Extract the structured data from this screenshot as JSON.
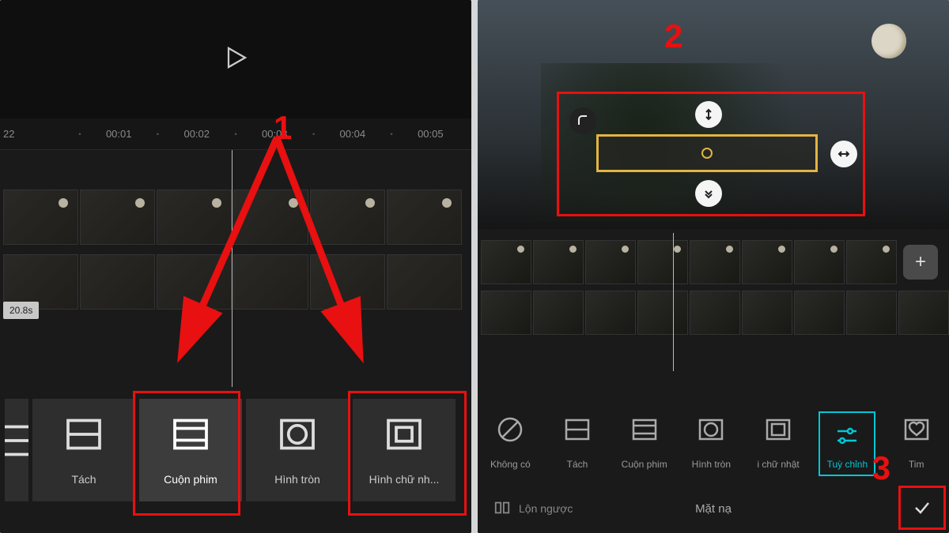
{
  "left": {
    "ruler": [
      "22",
      "00:01",
      "00:02",
      "00:03",
      "00:04",
      "00:05"
    ],
    "duration": "20.8s",
    "options": [
      {
        "id": "tach",
        "label": "Tách"
      },
      {
        "id": "cuonphim",
        "label": "Cuộn phim"
      },
      {
        "id": "hinhtron",
        "label": "Hình tròn"
      },
      {
        "id": "hinhchunhat",
        "label": "Hình chữ nh..."
      }
    ],
    "step": "1"
  },
  "right": {
    "step2": "2",
    "step3": "3",
    "options": [
      {
        "id": "khongco",
        "label": "Không có"
      },
      {
        "id": "tach2",
        "label": "Tách"
      },
      {
        "id": "cuonphim2",
        "label": "Cuộn phim"
      },
      {
        "id": "hinhtron2",
        "label": "Hình tròn"
      },
      {
        "id": "hinhchunhat2",
        "label": "i chữ nhật"
      },
      {
        "id": "tuychinh",
        "label": "Tuỳ chỉnh"
      },
      {
        "id": "tim",
        "label": "Tim"
      }
    ],
    "bottom_center": "Mặt nạ",
    "flip_label": "Lộn ngược"
  }
}
